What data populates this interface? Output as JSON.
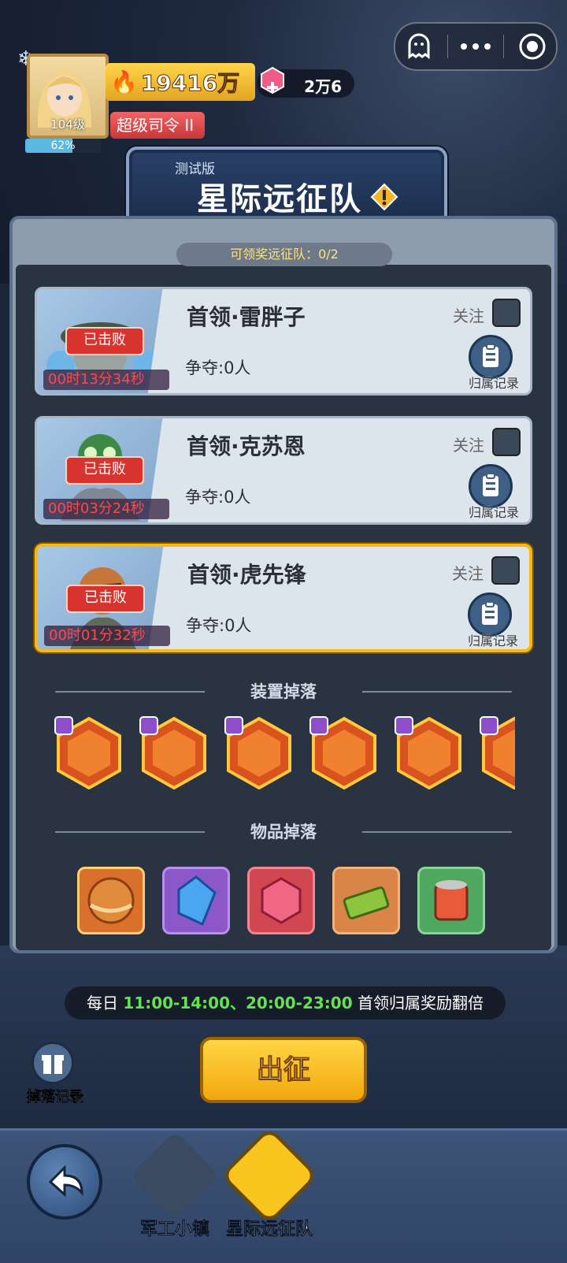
{
  "player": {
    "level": "104级",
    "exp_percent_label": "62%",
    "exp_percent": 0.62,
    "power": "19416万",
    "rank_title": "超级司令 II",
    "gems": "2万6"
  },
  "banner": {
    "beta_tag": "测试版",
    "title": "星际远征队"
  },
  "claimable": "可领奖远征队：0/2",
  "bosses": [
    {
      "name": "首领·雷胖子",
      "status": "已击败",
      "timer": "00时13分34秒",
      "contest": "争夺:0人",
      "follow": "关注",
      "record": "归属记录",
      "selected": false
    },
    {
      "name": "首领·克苏恩",
      "status": "已击败",
      "timer": "00时03分24秒",
      "contest": "争夺:0人",
      "follow": "关注",
      "record": "归属记录",
      "selected": false
    },
    {
      "name": "首领·虎先锋",
      "status": "已击败",
      "timer": "00时01分32秒",
      "contest": "争夺:0人",
      "follow": "关注",
      "record": "归属记录",
      "selected": true
    }
  ],
  "sections": {
    "equipment": "装置掉落",
    "items": "物品掉落"
  },
  "notice": {
    "prefix": "每日 ",
    "times": "11:00-14:00、20:00-23:00",
    "suffix": " 首领归属奖励翻倍"
  },
  "buttons": {
    "go": "出征",
    "drop_record": "掉落记录"
  },
  "nav": {
    "town": "军工小镇",
    "expedition": "星际远征队"
  },
  "colors": {
    "accent_gold": "#f7b816",
    "defeated_red": "#d9332f",
    "timer_red": "#ff4848",
    "highlight_green": "#62e34f"
  }
}
